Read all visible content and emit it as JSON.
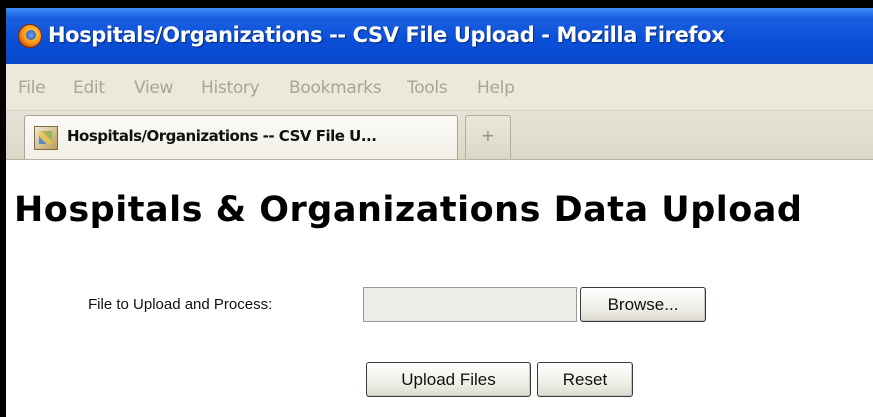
{
  "window": {
    "title": "Hospitals/Organizations -- CSV File Upload - Mozilla Firefox"
  },
  "menu": {
    "items": [
      "File",
      "Edit",
      "View",
      "History",
      "Bookmarks",
      "Tools",
      "Help"
    ]
  },
  "tabs": [
    {
      "label": "Hospitals/Organizations -- CSV File U..."
    }
  ],
  "new_tab": {
    "label": "+"
  },
  "page": {
    "heading": "Hospitals & Organizations Data Upload",
    "file_label": "File to Upload and Process:",
    "file_value": "",
    "browse_label": "Browse...",
    "upload_label": "Upload Files",
    "reset_label": "Reset"
  },
  "icons": {
    "app": "firefox-icon",
    "tab": "page-favicon"
  }
}
